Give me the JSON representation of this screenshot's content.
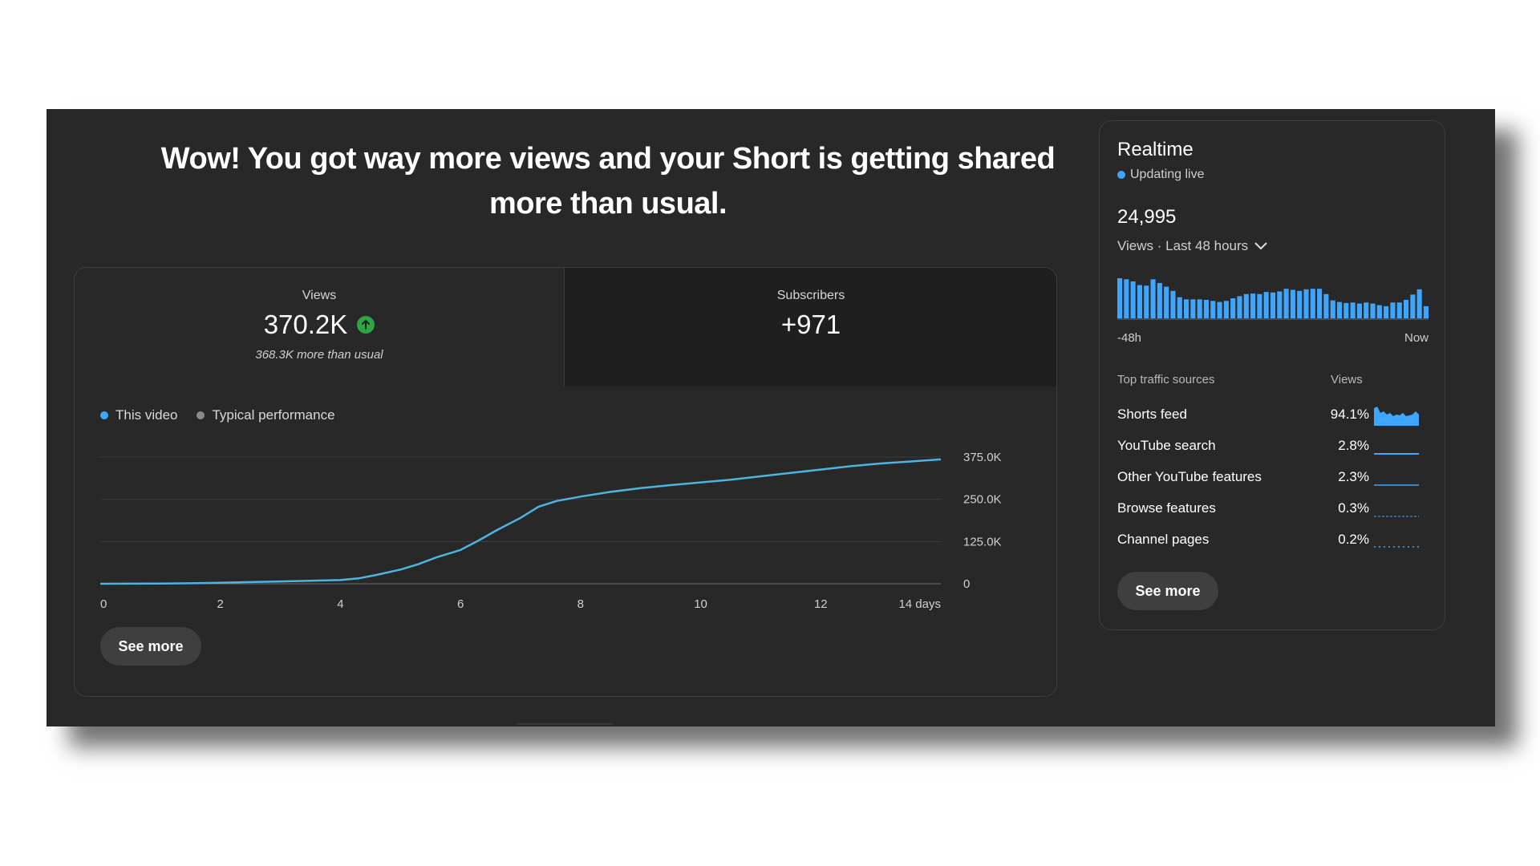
{
  "headline": "Wow! You got way more views and your Short is getting shared more than usual.",
  "stats": {
    "views": {
      "label": "Views",
      "value": "370.2K",
      "note": "368.3K more than usual"
    },
    "subscribers": {
      "label": "Subscribers",
      "value": "+971"
    }
  },
  "legend": {
    "this_video": "This video",
    "typical": "Typical performance"
  },
  "colors": {
    "accent": "#3ea6ff",
    "line": "#4fb3e0",
    "typical_dot": "#8a8a8a",
    "up": "#2ba640"
  },
  "chart_data": {
    "type": "line",
    "x_tick_labels": [
      "0",
      "2",
      "4",
      "6",
      "8",
      "10",
      "12",
      "14 days"
    ],
    "y_tick_labels": [
      "375.0K",
      "250.0K",
      "125.0K",
      "0"
    ],
    "xlim": [
      0,
      14
    ],
    "ylim": [
      0,
      375000
    ],
    "series": [
      {
        "name": "This video",
        "x": [
          0,
          1,
          1.5,
          2,
          2.5,
          3,
          3.5,
          4,
          4.3,
          4.6,
          5,
          5.3,
          5.6,
          6,
          6.3,
          6.6,
          7,
          7.3,
          7.6,
          8,
          8.5,
          9,
          9.5,
          10,
          10.5,
          11,
          11.5,
          12,
          12.5,
          13,
          13.5,
          14
        ],
        "y": [
          0,
          500,
          1500,
          3000,
          5000,
          7000,
          9000,
          11000,
          16000,
          26000,
          42000,
          58000,
          78000,
          100000,
          128000,
          158000,
          195000,
          228000,
          245000,
          258000,
          272000,
          283000,
          292000,
          300000,
          308000,
          318000,
          328000,
          338000,
          348000,
          356000,
          362000,
          368000
        ]
      }
    ],
    "grid": true
  },
  "see_more_label": "See more",
  "realtime": {
    "title": "Realtime",
    "live_label": "Updating live",
    "count": "24,995",
    "period_label": "Views · Last 48 hours",
    "axis_left": "-48h",
    "axis_right": "Now",
    "hourly_views": [
      760,
      740,
      700,
      630,
      620,
      740,
      670,
      600,
      520,
      400,
      360,
      360,
      360,
      350,
      330,
      310,
      330,
      380,
      420,
      460,
      470,
      460,
      500,
      490,
      510,
      560,
      540,
      520,
      550,
      560,
      560,
      460,
      340,
      310,
      290,
      300,
      280,
      300,
      280,
      250,
      230,
      300,
      300,
      350,
      450,
      550,
      230
    ],
    "traffic_header": {
      "source": "Top traffic sources",
      "views": "Views"
    },
    "traffic_sources": [
      {
        "name": "Shorts feed",
        "pct": "94.1%"
      },
      {
        "name": "YouTube search",
        "pct": "2.8%"
      },
      {
        "name": "Other YouTube features",
        "pct": "2.3%"
      },
      {
        "name": "Browse features",
        "pct": "0.3%"
      },
      {
        "name": "Channel pages",
        "pct": "0.2%"
      }
    ]
  }
}
